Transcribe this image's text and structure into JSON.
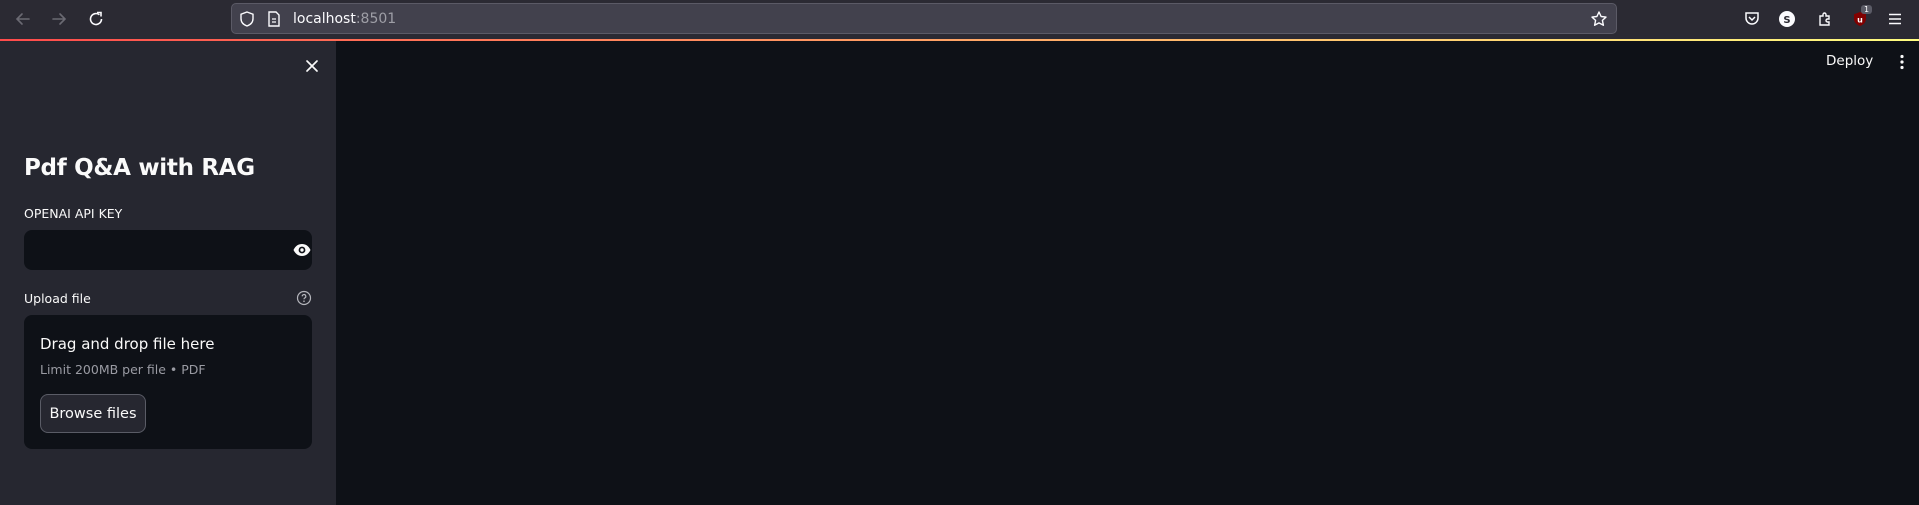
{
  "browser": {
    "url_host": "localhost",
    "url_port": ":8501",
    "extension_badge": "1"
  },
  "sidebar": {
    "title": "Pdf Q&A with RAG",
    "api_key_label": "OPENAI API KEY",
    "api_key_value": "",
    "upload_label": "Upload file",
    "uploader": {
      "drop_text": "Drag and drop file here",
      "limit_text": "Limit 200MB per file • PDF",
      "browse_label": "Browse files"
    }
  },
  "header": {
    "deploy_label": "Deploy"
  },
  "colors": {
    "sidebar_bg": "#262730",
    "main_bg": "#0e1117",
    "text": "#fafafa",
    "accent_red": "#ff4b4b",
    "accent_yellow": "#fffd80"
  },
  "icons": {
    "back": "back-arrow-icon",
    "forward": "forward-arrow-icon",
    "reload": "reload-icon",
    "shield": "shield-icon",
    "page": "page-icon",
    "star": "bookmark-star-icon",
    "pocket": "pocket-icon",
    "account": "account-icon",
    "extensions": "puzzle-icon",
    "ublock": "ublock-icon",
    "menu": "hamburger-menu-icon",
    "close": "close-icon",
    "eye": "eye-icon",
    "help": "help-icon",
    "kebab": "kebab-menu-icon"
  }
}
